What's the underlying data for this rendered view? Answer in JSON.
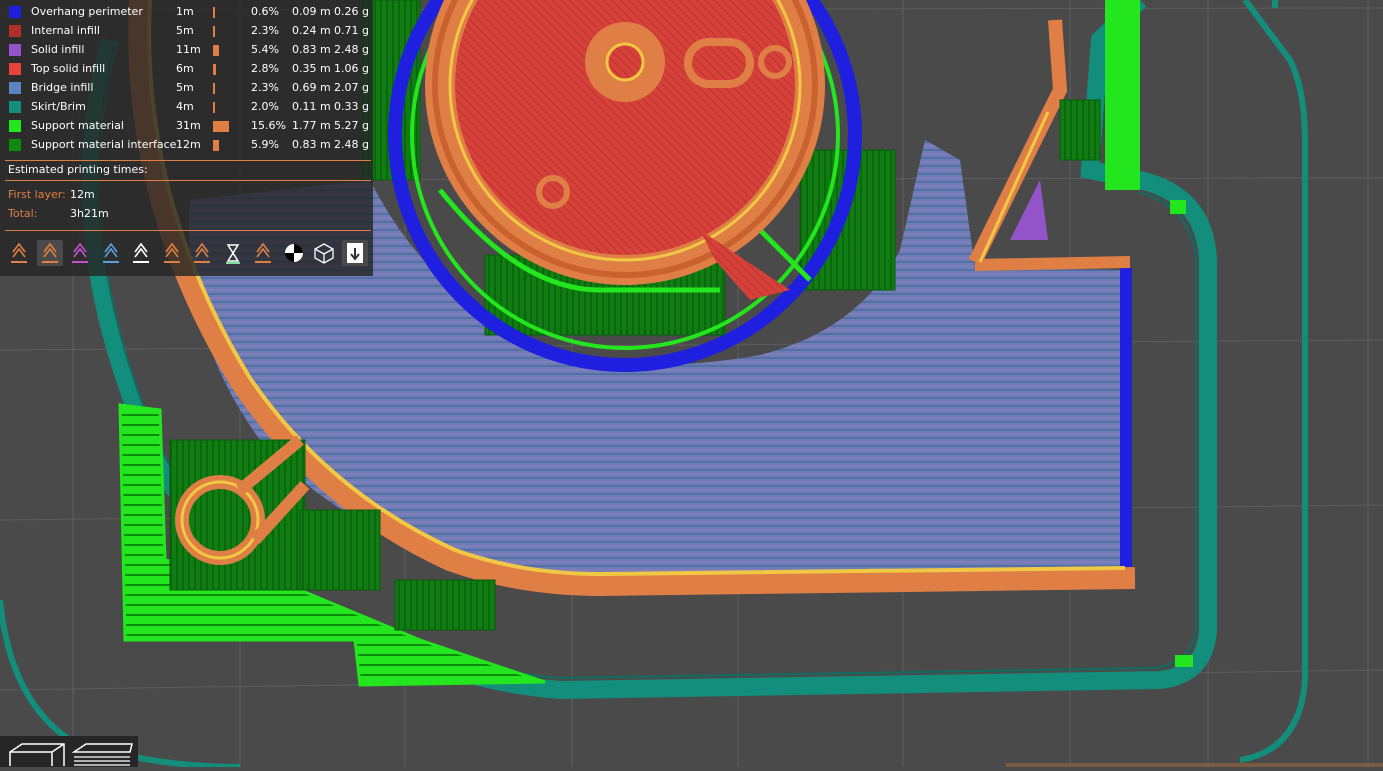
{
  "legend": {
    "rows": [
      {
        "name": "Overhang perimeter",
        "time": "1m",
        "percent": "0.6%",
        "length": "0.09 m",
        "weight": "0.26 g",
        "color": "#1f1fe0",
        "share": 0.006
      },
      {
        "name": "Internal infill",
        "time": "5m",
        "percent": "2.3%",
        "length": "0.24 m",
        "weight": "0.71 g",
        "color": "#b03029",
        "share": 0.023
      },
      {
        "name": "Solid infill",
        "time": "11m",
        "percent": "5.4%",
        "length": "0.83 m",
        "weight": "2.48 g",
        "color": "#9454c9",
        "share": 0.054
      },
      {
        "name": "Top solid infill",
        "time": "6m",
        "percent": "2.8%",
        "length": "0.35 m",
        "weight": "1.06 g",
        "color": "#e8423c",
        "share": 0.028
      },
      {
        "name": "Bridge infill",
        "time": "5m",
        "percent": "2.3%",
        "length": "0.69 m",
        "weight": "2.07 g",
        "color": "#5a83c1",
        "share": 0.023
      },
      {
        "name": "Skirt/Brim",
        "time": "4m",
        "percent": "2.0%",
        "length": "0.11 m",
        "weight": "0.33 g",
        "color": "#138d7c",
        "share": 0.02
      },
      {
        "name": "Support material",
        "time": "31m",
        "percent": "15.6%",
        "length": "1.77 m",
        "weight": "5.27 g",
        "color": "#23e61e",
        "share": 0.156
      },
      {
        "name": "Support material interface",
        "time": "12m",
        "percent": "5.9%",
        "length": "0.83 m",
        "weight": "2.48 g",
        "color": "#0e8a0e",
        "share": 0.059
      }
    ]
  },
  "estimates": {
    "title": "Estimated printing times:",
    "first_layer_label": "First layer:",
    "first_layer_value": "12m",
    "total_label": "Total:",
    "total_value": "3h21m"
  },
  "toolbar": {
    "icons": [
      "travel-icon",
      "wipe-icon",
      "retractions-icon",
      "deretractions-icon",
      "seams-icon",
      "tool-changes-icon",
      "color-changes-icon",
      "pause-prints-icon",
      "custom-gcodes-icon",
      "center-of-gravity-icon",
      "shells-icon",
      "tool-marker-icon"
    ]
  },
  "colors": {
    "panel_bg": "#262626",
    "accent": "#e07f45",
    "bed": "#4a4a4a",
    "skirt": "#138d7c",
    "support": "#23e61e",
    "support_interface": "#0e8a0e",
    "perimeter": "#e07f45",
    "external_perimeter": "#f0c844",
    "bridge": "#5a83c1",
    "overhang": "#1f1fe0",
    "top_solid": "#d8413a"
  }
}
